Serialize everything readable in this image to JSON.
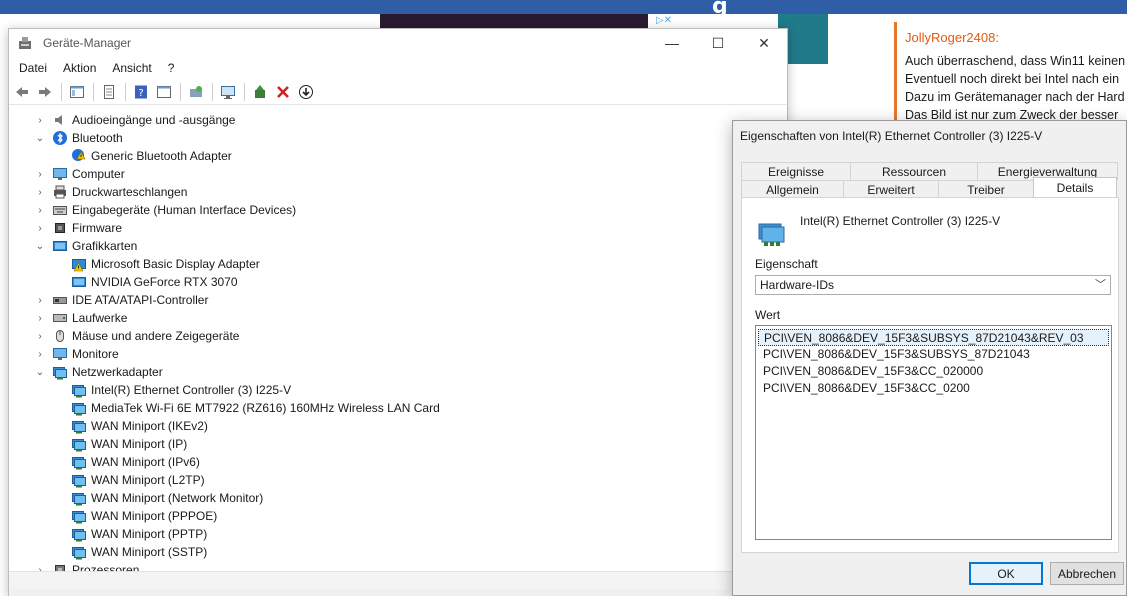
{
  "background": {
    "comment": {
      "author": "JollyRoger2408:",
      "lines": [
        "Auch überraschend, dass Win11 keinen",
        "Eventuell noch direkt bei Intel nach ein",
        "Dazu im Gerätemanager nach der Hard",
        "Das Bild ist nur zum Zweck der besser"
      ]
    },
    "ad_icons": "▷✕"
  },
  "device_manager": {
    "title": "Geräte-Manager",
    "window_buttons": {
      "minimize": "—",
      "maximize": "☐",
      "close": "✕"
    },
    "menu": [
      "Datei",
      "Aktion",
      "Ansicht",
      "?"
    ],
    "tree": [
      {
        "label": "Audioeingänge und -ausgänge",
        "level": 0,
        "state": "collapsed",
        "icon": "speaker-icon"
      },
      {
        "label": "Bluetooth",
        "level": 0,
        "state": "expanded",
        "icon": "bluetooth-icon"
      },
      {
        "label": "Generic Bluetooth Adapter",
        "level": 1,
        "state": "leaf",
        "icon": "bluetooth-warning-icon"
      },
      {
        "label": "Computer",
        "level": 0,
        "state": "collapsed",
        "icon": "monitor-icon"
      },
      {
        "label": "Druckwarteschlangen",
        "level": 0,
        "state": "collapsed",
        "icon": "printer-icon"
      },
      {
        "label": "Eingabegeräte (Human Interface Devices)",
        "level": 0,
        "state": "collapsed",
        "icon": "hid-icon"
      },
      {
        "label": "Firmware",
        "level": 0,
        "state": "collapsed",
        "icon": "chip-icon"
      },
      {
        "label": "Grafikkarten",
        "level": 0,
        "state": "expanded",
        "icon": "display-adapter-icon"
      },
      {
        "label": "Microsoft Basic Display Adapter",
        "level": 1,
        "state": "leaf",
        "icon": "display-warning-icon"
      },
      {
        "label": "NVIDIA GeForce RTX 3070",
        "level": 1,
        "state": "leaf",
        "icon": "display-adapter-icon"
      },
      {
        "label": "IDE ATA/ATAPI-Controller",
        "level": 0,
        "state": "collapsed",
        "icon": "ide-icon"
      },
      {
        "label": "Laufwerke",
        "level": 0,
        "state": "collapsed",
        "icon": "drive-icon"
      },
      {
        "label": "Mäuse und andere Zeigegeräte",
        "level": 0,
        "state": "collapsed",
        "icon": "mouse-icon"
      },
      {
        "label": "Monitore",
        "level": 0,
        "state": "collapsed",
        "icon": "monitor-icon"
      },
      {
        "label": "Netzwerkadapter",
        "level": 0,
        "state": "expanded",
        "icon": "network-icon"
      },
      {
        "label": "Intel(R) Ethernet Controller (3) I225-V",
        "level": 1,
        "state": "leaf",
        "icon": "network-icon"
      },
      {
        "label": "MediaTek Wi-Fi 6E MT7922 (RZ616) 160MHz Wireless LAN Card",
        "level": 1,
        "state": "leaf",
        "icon": "network-icon"
      },
      {
        "label": "WAN Miniport (IKEv2)",
        "level": 1,
        "state": "leaf",
        "icon": "network-icon"
      },
      {
        "label": "WAN Miniport (IP)",
        "level": 1,
        "state": "leaf",
        "icon": "network-icon"
      },
      {
        "label": "WAN Miniport (IPv6)",
        "level": 1,
        "state": "leaf",
        "icon": "network-icon"
      },
      {
        "label": "WAN Miniport (L2TP)",
        "level": 1,
        "state": "leaf",
        "icon": "network-icon"
      },
      {
        "label": "WAN Miniport (Network Monitor)",
        "level": 1,
        "state": "leaf",
        "icon": "network-icon"
      },
      {
        "label": "WAN Miniport (PPPOE)",
        "level": 1,
        "state": "leaf",
        "icon": "network-icon"
      },
      {
        "label": "WAN Miniport (PPTP)",
        "level": 1,
        "state": "leaf",
        "icon": "network-icon"
      },
      {
        "label": "WAN Miniport (SSTP)",
        "level": 1,
        "state": "leaf",
        "icon": "network-icon"
      },
      {
        "label": "Prozessoren",
        "level": 0,
        "state": "collapsed",
        "icon": "cpu-icon"
      }
    ]
  },
  "properties": {
    "title": "Eigenschaften von Intel(R) Ethernet Controller (3) I225-V",
    "tabs_top": [
      "Ereignisse",
      "Ressourcen",
      "Energieverwaltung"
    ],
    "tabs_bottom": [
      "Allgemein",
      "Erweitert",
      "Treiber",
      "Details"
    ],
    "active_tab": "Details",
    "device_name": "Intel(R) Ethernet Controller (3) I225-V",
    "property_label": "Eigenschaft",
    "property_value": "Hardware-IDs",
    "value_label": "Wert",
    "values": [
      "PCI\\VEN_8086&DEV_15F3&SUBSYS_87D21043&REV_03",
      "PCI\\VEN_8086&DEV_15F3&SUBSYS_87D21043",
      "PCI\\VEN_8086&DEV_15F3&CC_020000",
      "PCI\\VEN_8086&DEV_15F3&CC_0200"
    ],
    "ok_label": "OK",
    "cancel_label": "Abbrechen"
  }
}
